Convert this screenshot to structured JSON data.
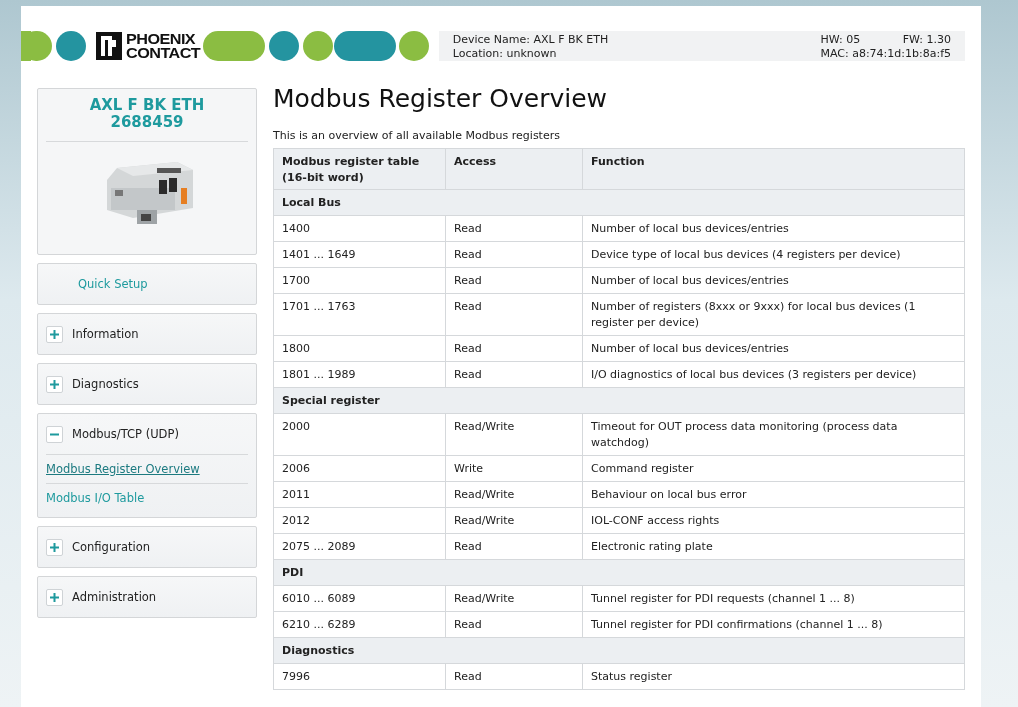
{
  "header": {
    "logo": {
      "line1": "PHOENIX",
      "line2": "CONTACT"
    },
    "device_name": "Device Name: AXL F BK ETH",
    "location": "Location: unknown",
    "hw": "HW: 05",
    "fw": "FW: 1.30",
    "mac": "MAC: a8:74:1d:1b:8a:f5"
  },
  "sidebar": {
    "product": {
      "name": "AXL F BK ETH",
      "number": "2688459"
    },
    "items": [
      {
        "label": "Quick Setup",
        "kind": "link"
      },
      {
        "label": "Information",
        "kind": "group",
        "expanded": false
      },
      {
        "label": "Diagnostics",
        "kind": "group",
        "expanded": false
      },
      {
        "label": "Modbus/TCP (UDP)",
        "kind": "group",
        "expanded": true,
        "children": [
          {
            "label": "Modbus Register Overview",
            "selected": true
          },
          {
            "label": "Modbus I/O Table",
            "selected": false
          }
        ]
      },
      {
        "label": "Configuration",
        "kind": "group",
        "expanded": false
      },
      {
        "label": "Administration",
        "kind": "group",
        "expanded": false
      }
    ]
  },
  "main": {
    "title": "Modbus Register Overview",
    "intro": "This is an overview of all available Modbus registers",
    "table": {
      "columns": [
        "Modbus register table (16-bit word)",
        "Access",
        "Function"
      ],
      "rows": [
        {
          "kind": "section",
          "label": "Local Bus"
        },
        {
          "kind": "data",
          "cells": [
            "1400",
            "Read",
            "Number of local bus devices/entries"
          ]
        },
        {
          "kind": "data",
          "cells": [
            "1401 ... 1649",
            "Read",
            "Device type of local bus devices (4 registers per device)"
          ]
        },
        {
          "kind": "data",
          "cells": [
            "1700",
            "Read",
            "Number of local bus devices/entries"
          ]
        },
        {
          "kind": "data",
          "cells": [
            "1701 ... 1763",
            "Read",
            "Number of registers (8xxx or 9xxx) for local bus devices (1 register per device)"
          ]
        },
        {
          "kind": "data",
          "cells": [
            "1800",
            "Read",
            "Number of local bus devices/entries"
          ]
        },
        {
          "kind": "data",
          "cells": [
            "1801 ... 1989",
            "Read",
            "I/O diagnostics of local bus devices (3 registers per device)"
          ]
        },
        {
          "kind": "section",
          "label": "Special register"
        },
        {
          "kind": "data",
          "cells": [
            "2000",
            "Read/Write",
            "Timeout for OUT process data monitoring (process data watchdog)"
          ]
        },
        {
          "kind": "data",
          "cells": [
            "2006",
            "Write",
            "Command register"
          ]
        },
        {
          "kind": "data",
          "cells": [
            "2011",
            "Read/Write",
            "Behaviour on local bus error"
          ]
        },
        {
          "kind": "data",
          "cells": [
            "2012",
            "Read/Write",
            "IOL-CONF access rights"
          ]
        },
        {
          "kind": "data",
          "cells": [
            "2075 ... 2089",
            "Read",
            "Electronic rating plate"
          ]
        },
        {
          "kind": "section",
          "label": "PDI"
        },
        {
          "kind": "data",
          "cells": [
            "6010 ... 6089",
            "Read/Write",
            "Tunnel register for PDI requests (channel 1 ... 8)"
          ]
        },
        {
          "kind": "data",
          "cells": [
            "6210 ... 6289",
            "Read",
            "Tunnel register for PDI confirmations (channel 1 ... 8)"
          ]
        },
        {
          "kind": "section",
          "label": "Diagnostics"
        },
        {
          "kind": "data",
          "cells": [
            "7996",
            "Read",
            "Status register"
          ]
        }
      ]
    }
  }
}
